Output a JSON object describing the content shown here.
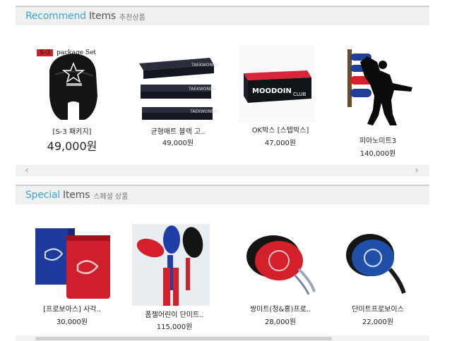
{
  "recommend": {
    "title_en1": "Recommend",
    "title_en2": "Items",
    "title_ko": "추천상품",
    "title_color": "#3aa6d8",
    "items": [
      {
        "name": "[S-3 패키지]",
        "price": "49,000원",
        "overlay_label": "S-3",
        "overlay_text": "package Set",
        "image_icon": "black-helmet-icon"
      },
      {
        "name": "균형매트 블랙 고..",
        "price": "49,000원",
        "image_icon": "balance-mat-icon"
      },
      {
        "name": "OK박스 [스텝박스]",
        "price": "47,000원",
        "image_icon": "step-box-icon",
        "box_text": "MOODOIN",
        "box_text2": "CLUB"
      },
      {
        "name": "피아노미트3",
        "price": "140,000원",
        "image_icon": "piano-mitt-icon"
      }
    ],
    "scroll_left": "‹",
    "scroll_right": "›"
  },
  "special": {
    "title_en1": "Special",
    "title_en2": "Items",
    "title_ko": "스페셜 상품",
    "title_color": "#3aa6d8",
    "items": [
      {
        "name": "[프로보아스] 사각..",
        "price": "30,000원",
        "image_icon": "square-mitt-icon"
      },
      {
        "name": "폼젤어린이 단미트..",
        "price": "115,000원",
        "image_icon": "kids-mitt-icon"
      },
      {
        "name": "쌍미트(청&홍)프로..",
        "price": "28,000원",
        "image_icon": "double-mitt-red-icon"
      },
      {
        "name": "단미트프로보이스",
        "price": "22,000원",
        "image_icon": "single-mitt-blue-icon"
      }
    ],
    "scroll_left": "‹",
    "scroll_right": "›"
  },
  "colors": {
    "header_bg": "#f0f0f0",
    "accent_blue": "#3aa6d8",
    "mitt_red": "#d4202a",
    "mitt_blue": "#1f4fa8"
  }
}
